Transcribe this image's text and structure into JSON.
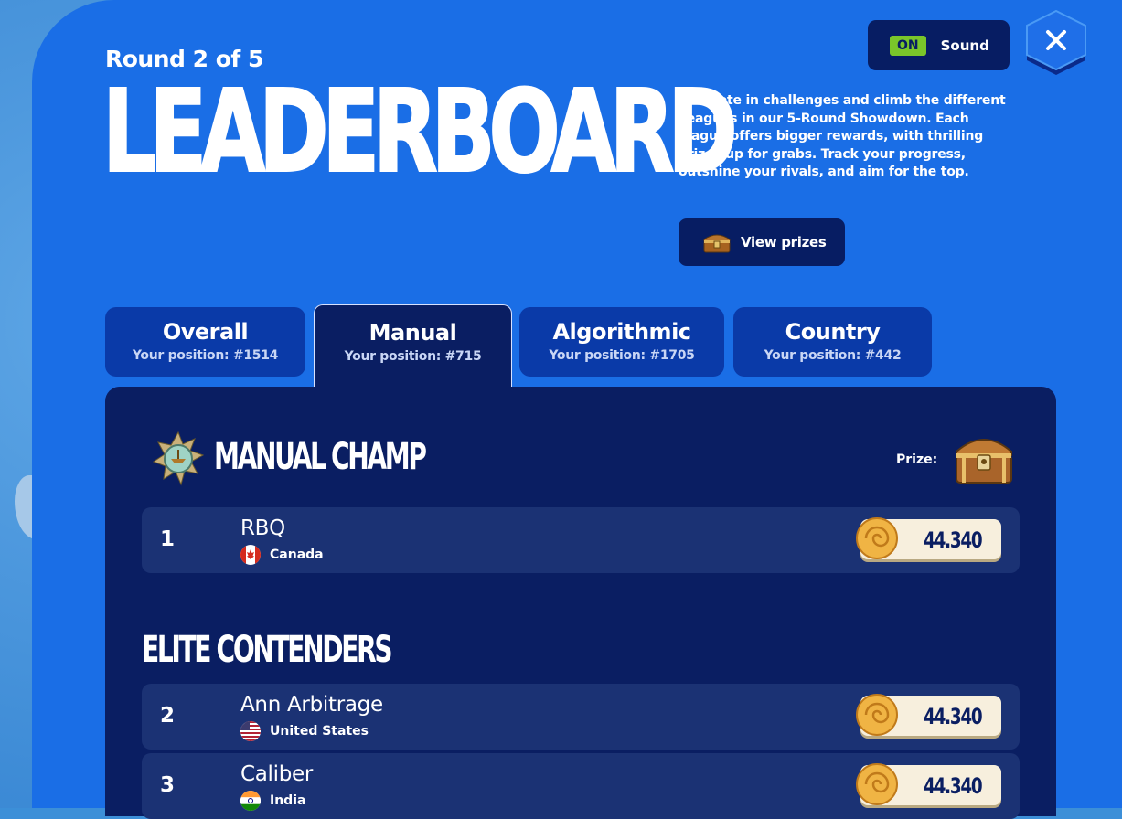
{
  "header": {
    "round": "Round 2 of 5",
    "title": "LEADERBOARD",
    "description": "Compete in challenges and climb the different Leagues in our 5-Round Showdown. Each league offers bigger rewards, with thrilling prizes up for grabs. Track your progress, outshine your rivals, and aim for the top.",
    "view_prizes_label": "View prizes"
  },
  "sound": {
    "state": "ON",
    "label": "Sound"
  },
  "tabs": [
    {
      "name": "Overall",
      "position": "Your position: #1514"
    },
    {
      "name": "Manual",
      "position": "Your position: #715"
    },
    {
      "name": "Algorithmic",
      "position": "Your position: #1705"
    },
    {
      "name": "Country",
      "position": "Your position: #442"
    }
  ],
  "active_tab": "Manual",
  "sections": {
    "champ": {
      "title": "MANUAL CHAMP",
      "prize_label": "Prize:"
    },
    "elite": {
      "title": "ELITE CONTENDERS"
    }
  },
  "rows": [
    {
      "rank": "1",
      "name": "RBQ",
      "country": "Canada",
      "flag_icon": "canada-flag-icon",
      "score": "44.340"
    },
    {
      "rank": "2",
      "name": "Ann Arbitrage",
      "country": "United States",
      "flag_icon": "us-flag-icon",
      "score": "44.340"
    },
    {
      "rank": "3",
      "name": "Caliber",
      "country": "India",
      "flag_icon": "india-flag-icon",
      "score": "44.340"
    }
  ],
  "colors": {
    "panel": "#1a6ee6",
    "board": "#0a1e62",
    "row": "#1b3274",
    "on_badge": "#7ac62a",
    "score_pill": "#f7efdd"
  }
}
